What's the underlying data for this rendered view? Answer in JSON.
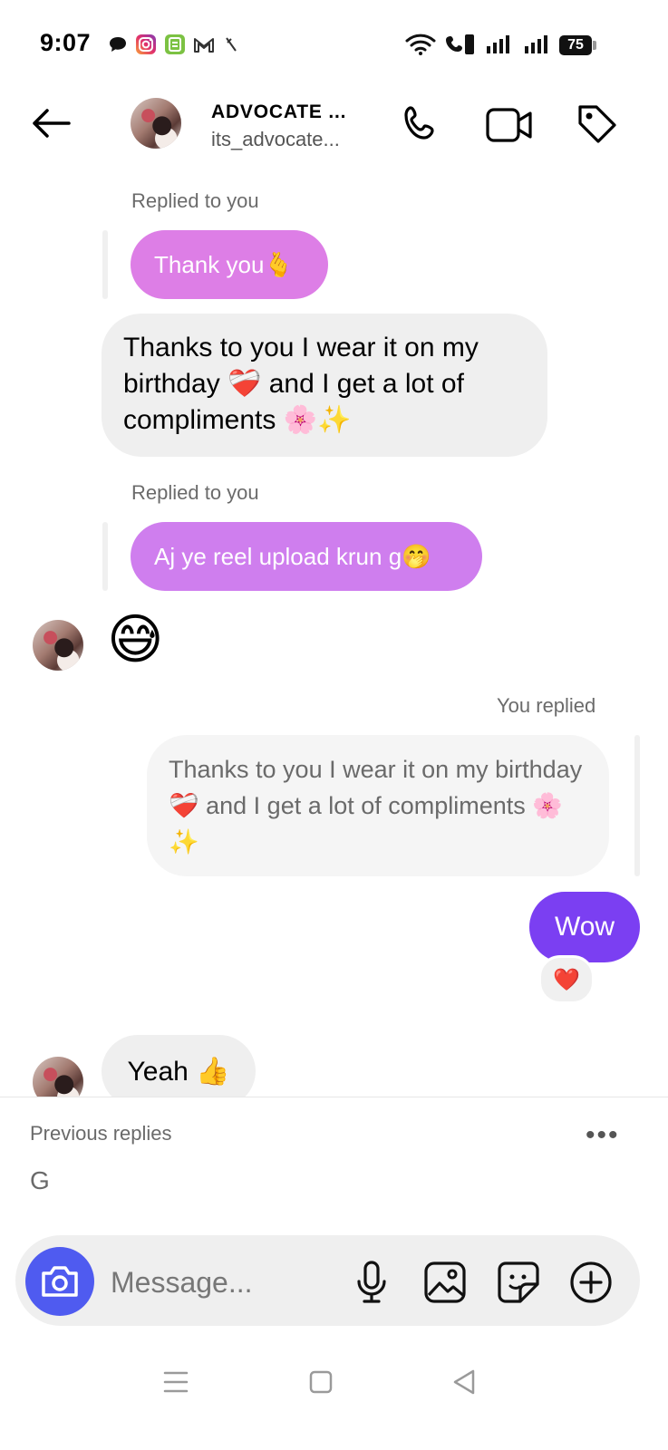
{
  "status_bar": {
    "time": "9:07",
    "battery": "75",
    "icons": [
      "chat-bubble-icon",
      "instagram-icon",
      "app-icon",
      "gmail-icon",
      "signal-slash-icon",
      "wifi-icon",
      "call-volte-icon",
      "cell-signal-icon",
      "cell-signal-icon"
    ]
  },
  "header": {
    "name": "ADVOCATE ...",
    "handle": "its_advocate...",
    "icons": [
      "back-arrow-icon",
      "phone-icon",
      "video-icon",
      "tag-icon"
    ]
  },
  "messages": {
    "reply1_meta": "Replied to you",
    "reply1_quote": "Thank you🫰",
    "msg1": "Thanks to you I wear it on my birthday ❤️‍🩹 and I get a lot of compliments 🌸✨",
    "reply2_meta": "Replied to you",
    "reply2_quote": "Aj ye reel upload krun g🤭",
    "emoji_msg": "😅",
    "you_replied_meta": "You replied",
    "quoted_own": "Thanks to you I wear it on my birthday ❤️‍🩹 and I get a lot of compliments 🌸✨",
    "wow": "Wow",
    "reaction": "❤️",
    "yeah": "Yeah 👍"
  },
  "previous_replies": {
    "label": "Previous replies",
    "item": "G",
    "more": "•••"
  },
  "composer": {
    "placeholder": "Message...",
    "icons": [
      "camera-icon",
      "mic-icon",
      "gallery-icon",
      "sticker-icon",
      "plus-circle-icon"
    ]
  },
  "colors": {
    "accent_purple": "#7b3ff2",
    "quote_pink": "#dd7ee6",
    "camera_blue": "#4f5bf0"
  }
}
